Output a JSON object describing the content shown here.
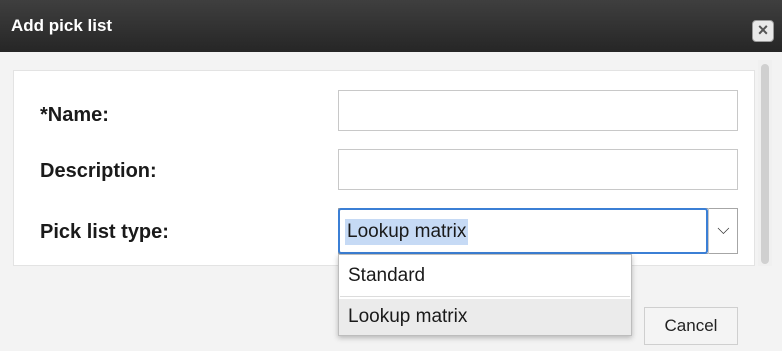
{
  "dialog": {
    "title": "Add pick list",
    "close_icon": "close-icon"
  },
  "form": {
    "name_label": "*Name:",
    "name_value": "",
    "description_label": "Description:",
    "description_value": "",
    "type_label": "Pick list type:",
    "type_selected": "Lookup matrix"
  },
  "dropdown": {
    "options": [
      "Standard",
      "Lookup matrix"
    ],
    "highlighted": "Lookup matrix"
  },
  "footer": {
    "cancel_label": "Cancel"
  },
  "colors": {
    "titlebar": "#262626",
    "focus_border": "#3b7fd5",
    "selection": "#c6daf5"
  }
}
